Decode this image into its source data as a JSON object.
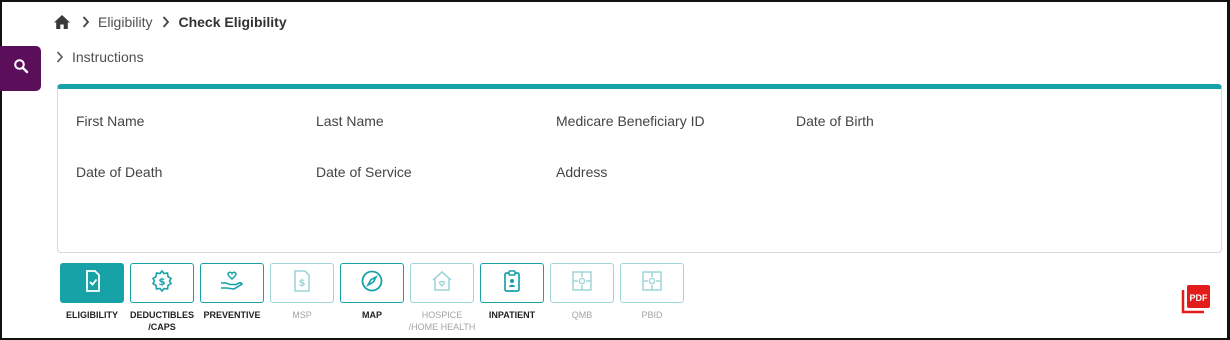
{
  "breadcrumb": {
    "home_icon": "home-icon",
    "items": [
      "Eligibility",
      "Check Eligibility"
    ]
  },
  "search_tab": {
    "icon": "search-icon"
  },
  "instructions": {
    "label": "Instructions"
  },
  "beneficiary": {
    "fields": {
      "first_name": "First Name",
      "last_name": "Last Name",
      "mbi": "Medicare Beneficiary ID",
      "dob": "Date of Birth",
      "dod": "Date of Death",
      "dos": "Date of Service",
      "address": "Address"
    }
  },
  "tabs": [
    {
      "label": "ELIGIBILITY",
      "icon": "clipboard-check-icon",
      "state": "active"
    },
    {
      "label": "DEDUCTIBLES\n/CAPS",
      "icon": "dollar-gear-icon",
      "state": "enabled"
    },
    {
      "label": "PREVENTIVE",
      "icon": "hand-heart-icon",
      "state": "enabled"
    },
    {
      "label": "MSP",
      "icon": "dollar-document-icon",
      "state": "disabled"
    },
    {
      "label": "MAP",
      "icon": "compass-icon",
      "state": "enabled"
    },
    {
      "label": "HOSPICE\n/HOME HEALTH",
      "icon": "house-heart-icon",
      "state": "disabled"
    },
    {
      "label": "INPATIENT",
      "icon": "clipboard-person-icon",
      "state": "enabled"
    },
    {
      "label": "QMB",
      "icon": "puzzle-icon",
      "state": "disabled"
    },
    {
      "label": "PBID",
      "icon": "puzzle-icon",
      "state": "disabled"
    }
  ],
  "pdf_button": {
    "label": "PDF",
    "icon": "pdf-icon"
  },
  "colors": {
    "teal": "#17a2a8",
    "teal_disabled": "#9fd6d8",
    "purple": "#5b0f5a",
    "pdf_red": "#e21b1b"
  }
}
